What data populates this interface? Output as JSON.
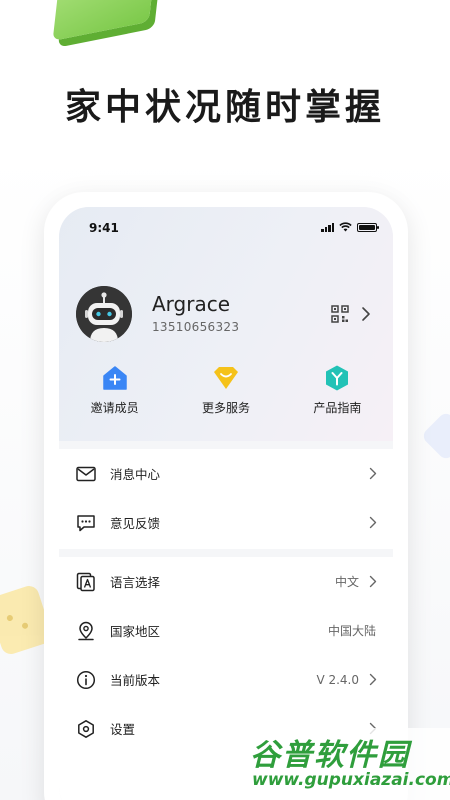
{
  "headline": "家中状况随时掌握",
  "status_bar": {
    "time": "9:41"
  },
  "profile": {
    "name": "Argrace",
    "phone": "13510656323"
  },
  "quick_actions": [
    {
      "label": "邀请成员",
      "icon": "house-plus-icon",
      "color": "#3a86f5"
    },
    {
      "label": "更多服务",
      "icon": "diamond-icon",
      "color": "#f5c21a"
    },
    {
      "label": "产品指南",
      "icon": "hexagon-y-icon",
      "color": "#22c2b6"
    }
  ],
  "menu_group_1": [
    {
      "label": "消息中心",
      "icon": "envelope-icon"
    },
    {
      "label": "意见反馈",
      "icon": "chat-bubble-icon"
    }
  ],
  "menu_group_2": [
    {
      "label": "语言选择",
      "value": "中文",
      "icon": "language-icon"
    },
    {
      "label": "国家地区",
      "value": "中国大陆",
      "icon": "location-pin-icon"
    },
    {
      "label": "当前版本",
      "value": "V 2.4.0",
      "icon": "info-icon"
    },
    {
      "label": "设置",
      "icon": "settings-hexagon-icon"
    }
  ],
  "watermark": {
    "brand": "谷普软件园",
    "url": "www.gupuxiazai.com"
  },
  "colors": {
    "watermark_green": "#2f9e3c",
    "accent_blue": "#3a86f5",
    "accent_yellow": "#f5c21a",
    "accent_teal": "#22c2b6"
  }
}
